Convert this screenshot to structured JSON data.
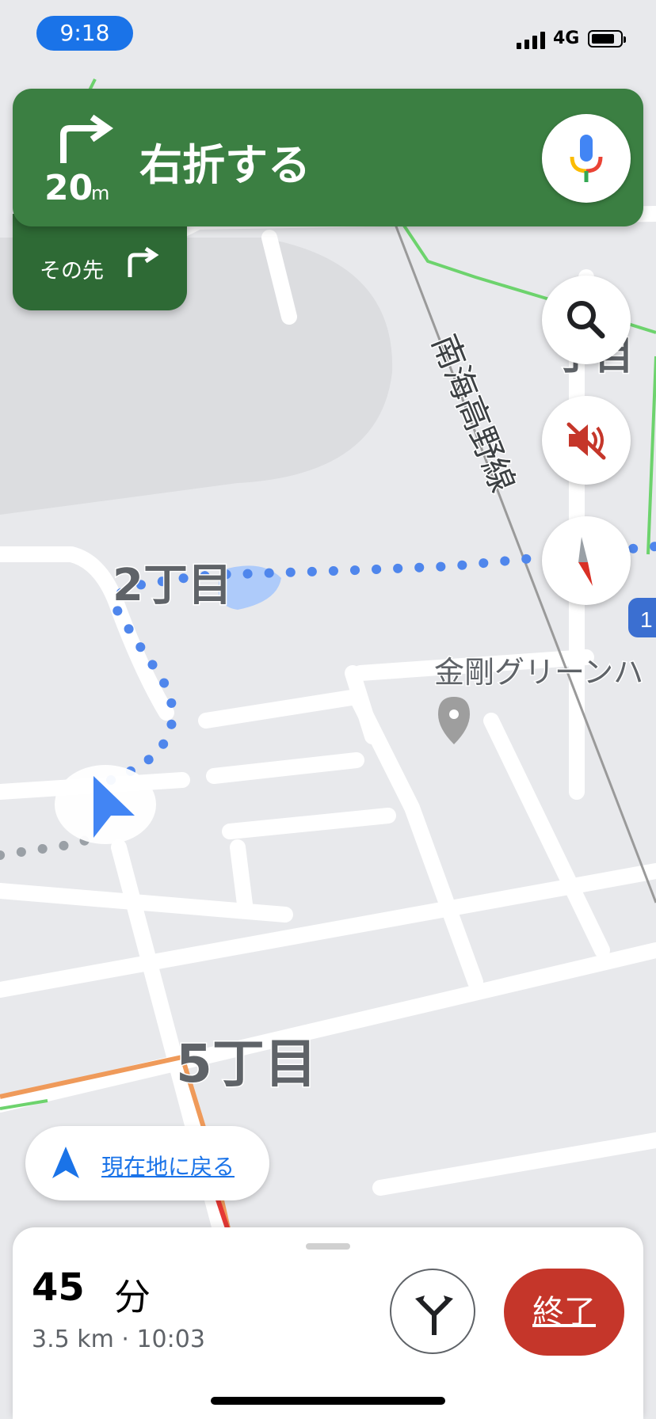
{
  "status_bar": {
    "time": "9:18",
    "network": "4G"
  },
  "navigation": {
    "instruction": "右折する",
    "distance_value": "20",
    "distance_unit": "m",
    "then_label": "その先",
    "maneuver_icon": "turn-right-icon",
    "primary_color": "#3b7f42"
  },
  "map": {
    "labels": {
      "district_2": "2丁目",
      "district_5": "5丁目",
      "district_partial": "丁目",
      "railway": "南海高野線",
      "poi": "金剛グリーンハ",
      "route_badge": "1"
    }
  },
  "buttons": {
    "recenter_label": "現在地に戻る",
    "end_label": "終了",
    "search_icon": "search-icon",
    "mute_icon": "volume-off-icon",
    "compass_icon": "compass-icon",
    "alternate_icon": "alternate-routes-icon"
  },
  "trip": {
    "eta_minutes": "45",
    "eta_unit": "分",
    "details": "3.5 km · 10:03"
  }
}
